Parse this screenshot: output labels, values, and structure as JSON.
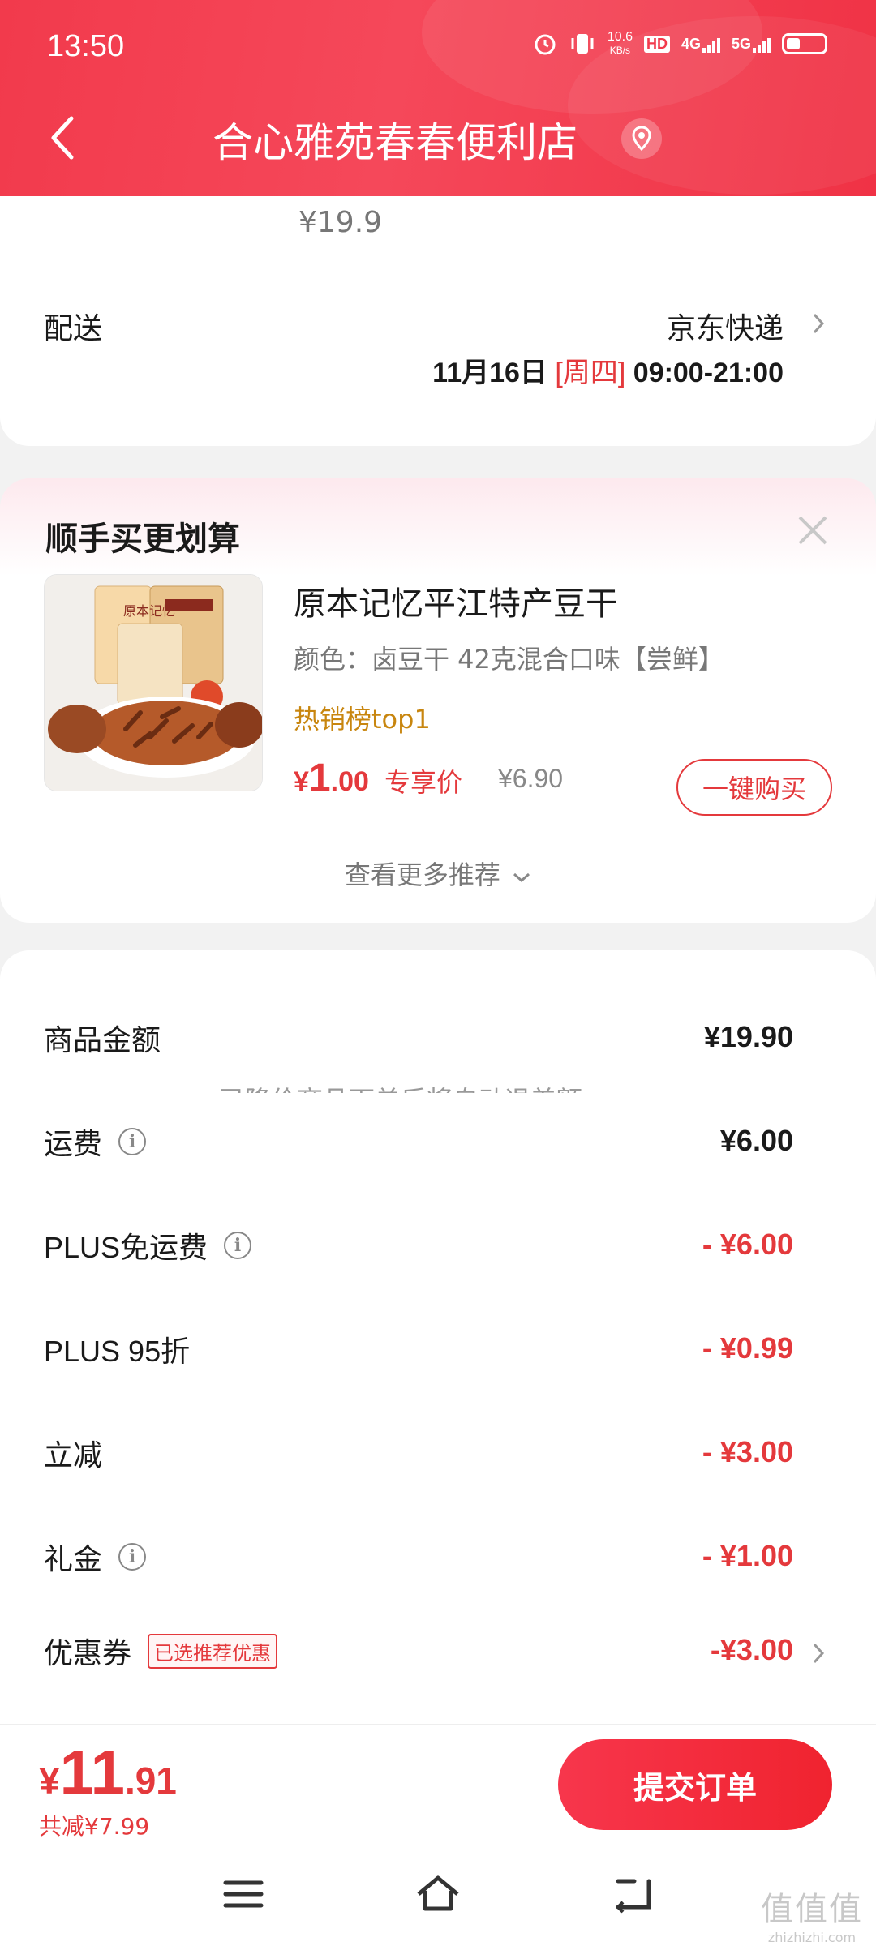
{
  "status_bar": {
    "time": "13:50",
    "net_speed_value": "10.6",
    "net_speed_unit": "KB/s",
    "hd_label": "HD",
    "signal_1": "4G",
    "signal_2": "5G"
  },
  "header": {
    "title": "合心雅苑春春便利店"
  },
  "delivery": {
    "item_price": "¥19.9",
    "label": "配送",
    "courier": "京东快递",
    "date": "11月16日",
    "weekday": "[周四]",
    "time_window": "09:00-21:00"
  },
  "recommend": {
    "title": "顺手买更划算",
    "product": {
      "name": "原本记忆平江特产豆干",
      "spec": "颜色：卤豆干 42克混合口味【尝鲜】",
      "tag": "热销榜top1",
      "price_currency": "¥",
      "price_int": "1",
      "price_dec": ".00",
      "price_label": "专享价",
      "original_price": "¥6.90",
      "buy_label": "一键购买",
      "package_text": "原本记忆"
    },
    "more_label": "查看更多推荐"
  },
  "summary": {
    "rows": [
      {
        "label": "商品金额",
        "value": "¥19.90"
      },
      {
        "label": "运费",
        "value": "¥6.00"
      },
      {
        "label": "PLUS免运费",
        "value": "- ¥6.00"
      },
      {
        "label": "PLUS 95折",
        "value": "- ¥0.99"
      },
      {
        "label": "立减",
        "value": "- ¥3.00"
      },
      {
        "label": "礼金",
        "value": "- ¥1.00"
      },
      {
        "label": "优惠券",
        "badge": "已选推荐优惠",
        "value": "-¥3.00"
      }
    ],
    "cut_text": "已降价商品下单后将自动退差额"
  },
  "bottom": {
    "total_currency": "¥",
    "total_int": "11",
    "total_dec": ".91",
    "saved": "共减¥7.99",
    "submit_label": "提交订单"
  },
  "watermark": {
    "big": "值值值",
    "small": "zhizhizhi.com"
  },
  "colors": {
    "brand_red": "#e4393c",
    "header_red": "#f23a4c",
    "tag_orange": "#c8860f"
  }
}
